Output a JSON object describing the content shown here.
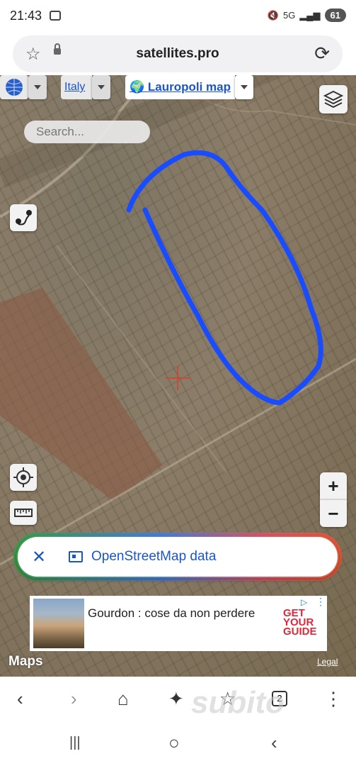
{
  "status": {
    "time": "21:43",
    "network": "5G",
    "battery": "61"
  },
  "browser": {
    "url": "satellites.pro",
    "tabs_count": "2"
  },
  "map": {
    "country_link": "Italy",
    "place_link": "Lauropoli map",
    "search_placeholder": "Search...",
    "zoom_in": "+",
    "zoom_out": "−",
    "osm_label": "OpenStreetMap data",
    "osm_close": "✕",
    "provider": "Maps",
    "legal": "Legal",
    "outline_color": "#1a4cff"
  },
  "ad": {
    "title": "Gourdon : cose da non perdere",
    "brand_line1": "GET",
    "brand_line2": "YOUR",
    "brand_line3": "GUIDE"
  },
  "watermark": "subito",
  "icons": {
    "star": "☆",
    "reload": "⟳",
    "back": "‹",
    "forward": "›",
    "home": "⌂",
    "sparkle": "✦",
    "bookmark": "☆",
    "menu": "⋮",
    "recents": "|||",
    "home_nav": "○",
    "back_nav": "‹"
  }
}
